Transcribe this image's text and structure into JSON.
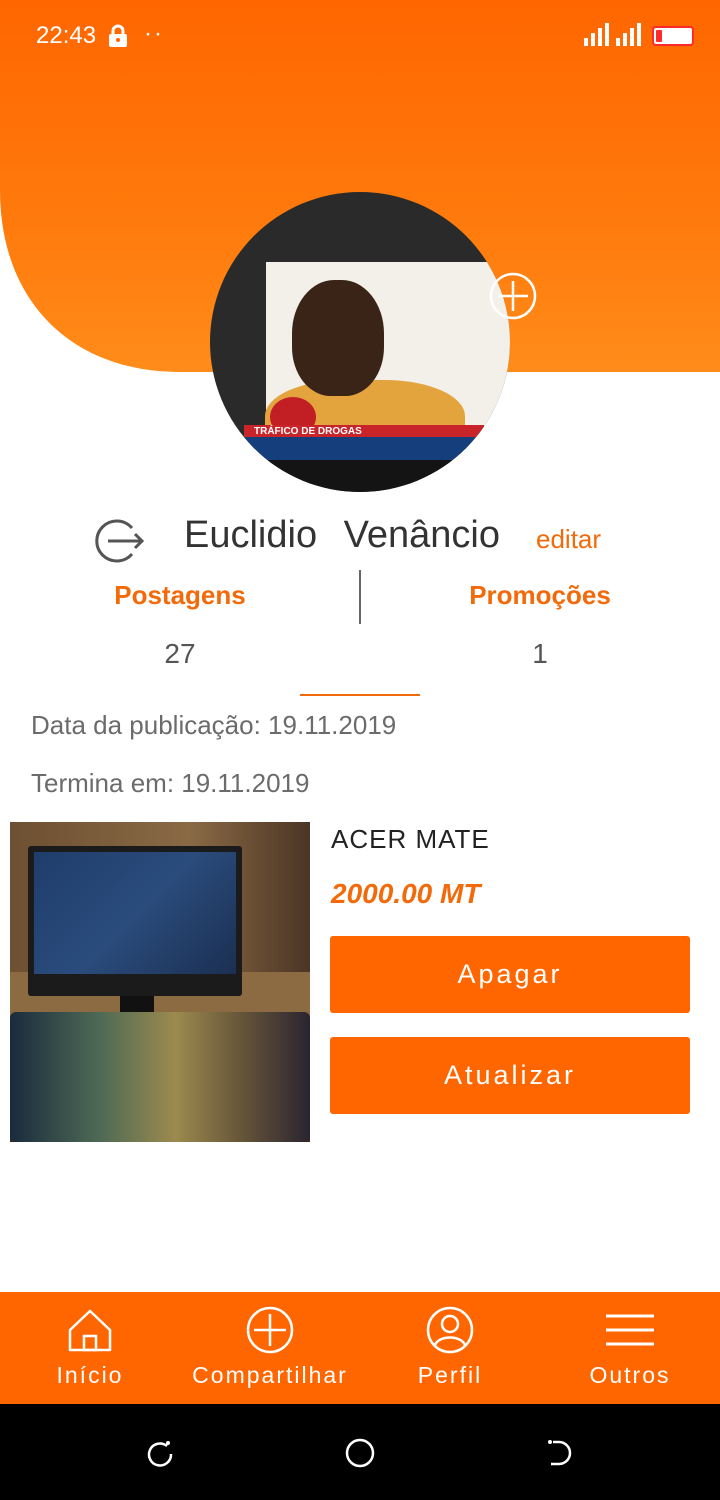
{
  "status_bar": {
    "time": "22:43",
    "dots": "··"
  },
  "profile": {
    "name": "Euclidio Venâncio",
    "edit_label": "editar",
    "stats": [
      {
        "label": "Postagens",
        "count": "27"
      },
      {
        "label": "Promoções",
        "count": "1"
      }
    ]
  },
  "post": {
    "publication_label": "Data da publicação: 19.11.2019",
    "end_label": "Termina em: 19.11.2019",
    "title": "ACER MATE",
    "price": "2000.00 MT",
    "delete_label": "Apagar",
    "update_label": "Atualizar",
    "photo_icon": "monitor-setup-photo"
  },
  "avatar_photo": {
    "banner_text": "TRÁFICO DE DROGAS"
  },
  "bottom_nav": {
    "items": [
      {
        "label": "Início",
        "icon": "home-icon"
      },
      {
        "label": "Compartilhar",
        "icon": "plus-circle-icon"
      },
      {
        "label": "Perfil",
        "icon": "user-icon"
      },
      {
        "label": "Outros",
        "icon": "menu-icon"
      }
    ]
  },
  "colors": {
    "accent": "#ff6600",
    "text_accent": "#f26a0a",
    "battery_low": "#ff2a2a"
  }
}
